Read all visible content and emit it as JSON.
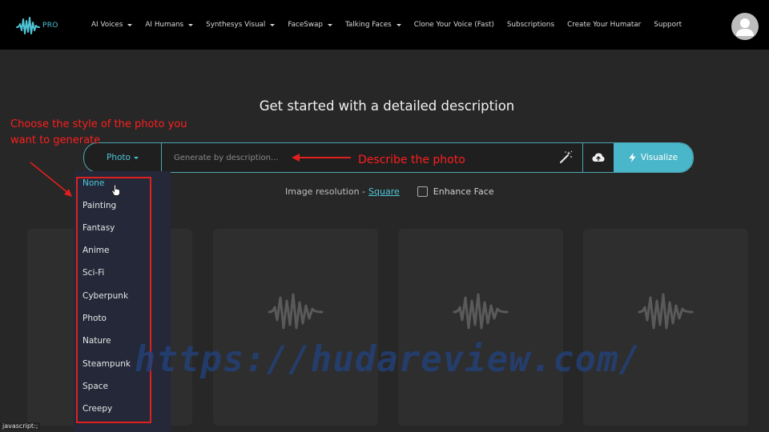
{
  "brand": {
    "badge": "PRO",
    "accent": "#4fc6d8"
  },
  "nav": {
    "items": [
      {
        "label": "AI Voices",
        "dropdown": true
      },
      {
        "label": "AI Humans",
        "dropdown": true
      },
      {
        "label": "Synthesys Visual",
        "dropdown": true
      },
      {
        "label": "FaceSwap",
        "dropdown": true
      },
      {
        "label": "Talking Faces",
        "dropdown": true
      },
      {
        "label": "Clone Your Voice (Fast)",
        "dropdown": false
      },
      {
        "label": "Subscriptions",
        "dropdown": false
      },
      {
        "label": "Create Your Humatar",
        "dropdown": false
      },
      {
        "label": "Support",
        "dropdown": false
      }
    ]
  },
  "main": {
    "headline": "Get started with a detailed description",
    "search": {
      "style_label": "Photo",
      "placeholder": "Generate by description...",
      "value": "",
      "visualize_label": "Visualize",
      "icons": [
        "magic-wand-icon",
        "cloud-upload-icon",
        "lightning-icon"
      ]
    },
    "options": {
      "resolution_label": "Image resolution -",
      "resolution_value": "Square",
      "enhance_label": "Enhance Face",
      "enhance_checked": false
    },
    "cards_count": 4
  },
  "style_dropdown": {
    "options": [
      "None",
      "Painting",
      "Fantasy",
      "Anime",
      "Sci-Fi",
      "Cyberpunk",
      "Photo",
      "Nature",
      "Steampunk",
      "Space",
      "Creepy"
    ],
    "highlighted": "None"
  },
  "annotations": {
    "left_line1": "Choose the style of the photo you",
    "left_line2": "want to generate",
    "right": "Describe the photo",
    "color": "#ff1e1e"
  },
  "watermark": "https://hudareview.com/",
  "status_bar": "javascript:;"
}
